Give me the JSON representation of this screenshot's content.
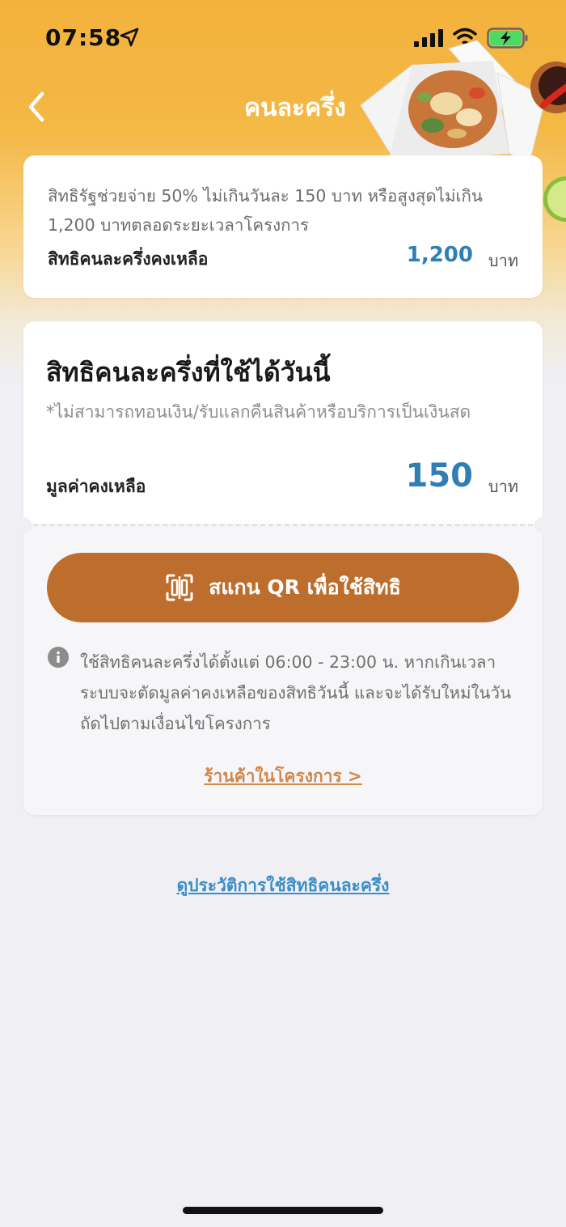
{
  "status_bar": {
    "time": "07:58",
    "icons": [
      "location-arrow-icon",
      "cell-signal-icon",
      "wifi-icon",
      "battery-charging-icon"
    ]
  },
  "header": {
    "title": "คนละครึ่ง",
    "back_icon": "chevron-left-icon"
  },
  "summary": {
    "description": "สิทธิรัฐช่วยจ่าย 50% ไม่เกินวันละ 150 บาท หรือสูงสุดไม่เกิน 1,200 บาทตลอดระยะเวลาโครงการ",
    "remaining_label": "สิทธิคนละครึ่งคงเหลือ",
    "remaining_amount": "1,200",
    "unit": "บาท"
  },
  "today": {
    "title": "สิทธิคนละครึ่งที่ใช้ได้วันนี้",
    "note": "*ไม่สามารถทอนเงิน/รับแลกคืนสินค้าหรือบริการเป็นเงินสด",
    "balance_label": "มูลค่าคงเหลือ",
    "balance_amount": "150",
    "unit": "บาท",
    "scan_button_label": "สแกน QR เพื่อใช้สิทธิ",
    "scan_icon": "qr-scan-icon",
    "info_text": "ใช้สิทธิคนละครึ่งได้ตั้งแต่ 06:00 - 23:00 น. หากเกินเวลา ระบบจะตัดมูลค่าคงเหลือของสิทธิวันนี้ และจะได้รับใหม่ในวันถัดไปตามเงื่อนไขโครงการ",
    "stores_link": "ร้านค้าในโครงการ >"
  },
  "history_link": "ดูประวัติการใช้สิทธิคนละครึ่ง",
  "colors": {
    "accent_brown": "#bd6e2d",
    "amount_blue": "#2f7fb5",
    "link_orange": "#d1874a",
    "link_blue": "#3a8ec6",
    "header_orange": "#f3b23c"
  }
}
